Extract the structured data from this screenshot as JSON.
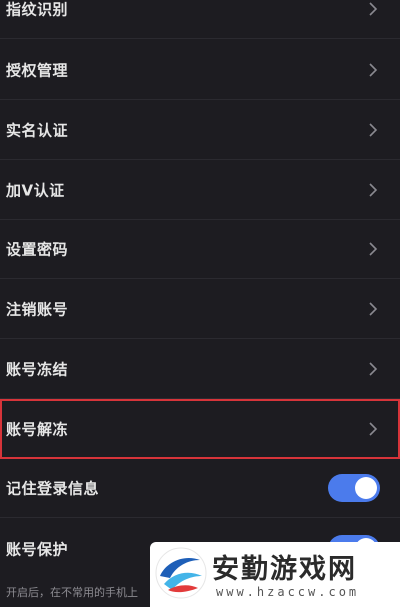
{
  "settings": {
    "items": [
      {
        "label": "指纹识别"
      },
      {
        "label": "授权管理"
      },
      {
        "label": "实名认证"
      },
      {
        "label": "加V认证"
      },
      {
        "label": "设置密码"
      },
      {
        "label": "注销账号"
      },
      {
        "label": "账号冻结"
      },
      {
        "label": "账号解冻",
        "highlighted": true
      }
    ],
    "toggles": [
      {
        "label": "记住登录信息",
        "on": true
      },
      {
        "label": "账号保护",
        "on": true
      }
    ],
    "footer_note": "开启后，在不常用的手机上"
  },
  "watermark": {
    "name": "安勤游戏网",
    "url": "www.hzaccw.com"
  },
  "colors": {
    "background": "#1d1c21",
    "toggle_on": "#4b7bec",
    "highlight_border": "#d7343a"
  }
}
